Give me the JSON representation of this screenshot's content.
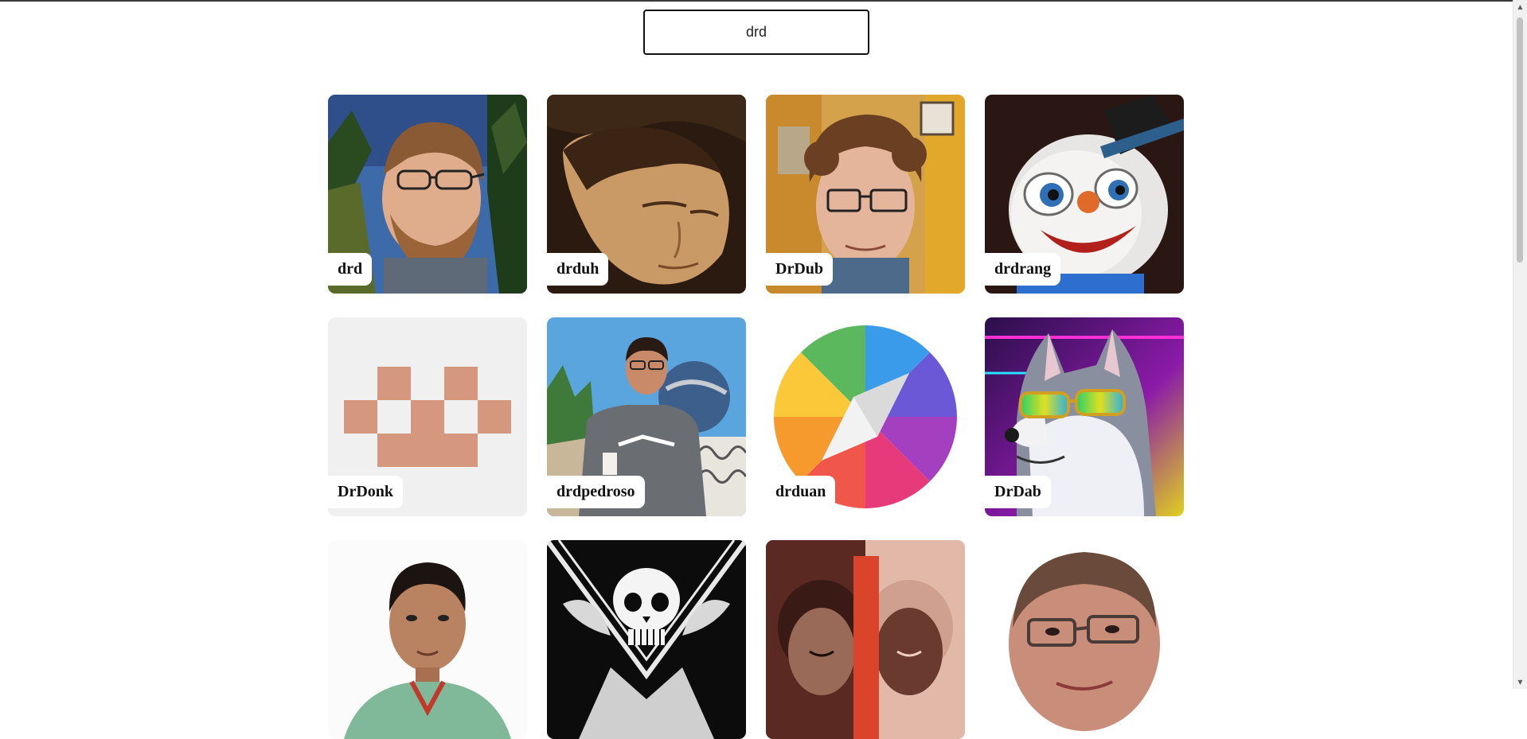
{
  "search": {
    "value": "drd",
    "placeholder": ""
  },
  "results": [
    {
      "name": "drd"
    },
    {
      "name": "drduh"
    },
    {
      "name": "DrDub"
    },
    {
      "name": "drdrang"
    },
    {
      "name": "DrDonk"
    },
    {
      "name": "drdpedroso"
    },
    {
      "name": "drduan"
    },
    {
      "name": "DrDab"
    },
    {
      "name": ""
    },
    {
      "name": ""
    },
    {
      "name": ""
    },
    {
      "name": ""
    }
  ],
  "scrollbar": {
    "up_icon": "triangle-up-icon",
    "down_icon": "triangle-down-icon"
  }
}
